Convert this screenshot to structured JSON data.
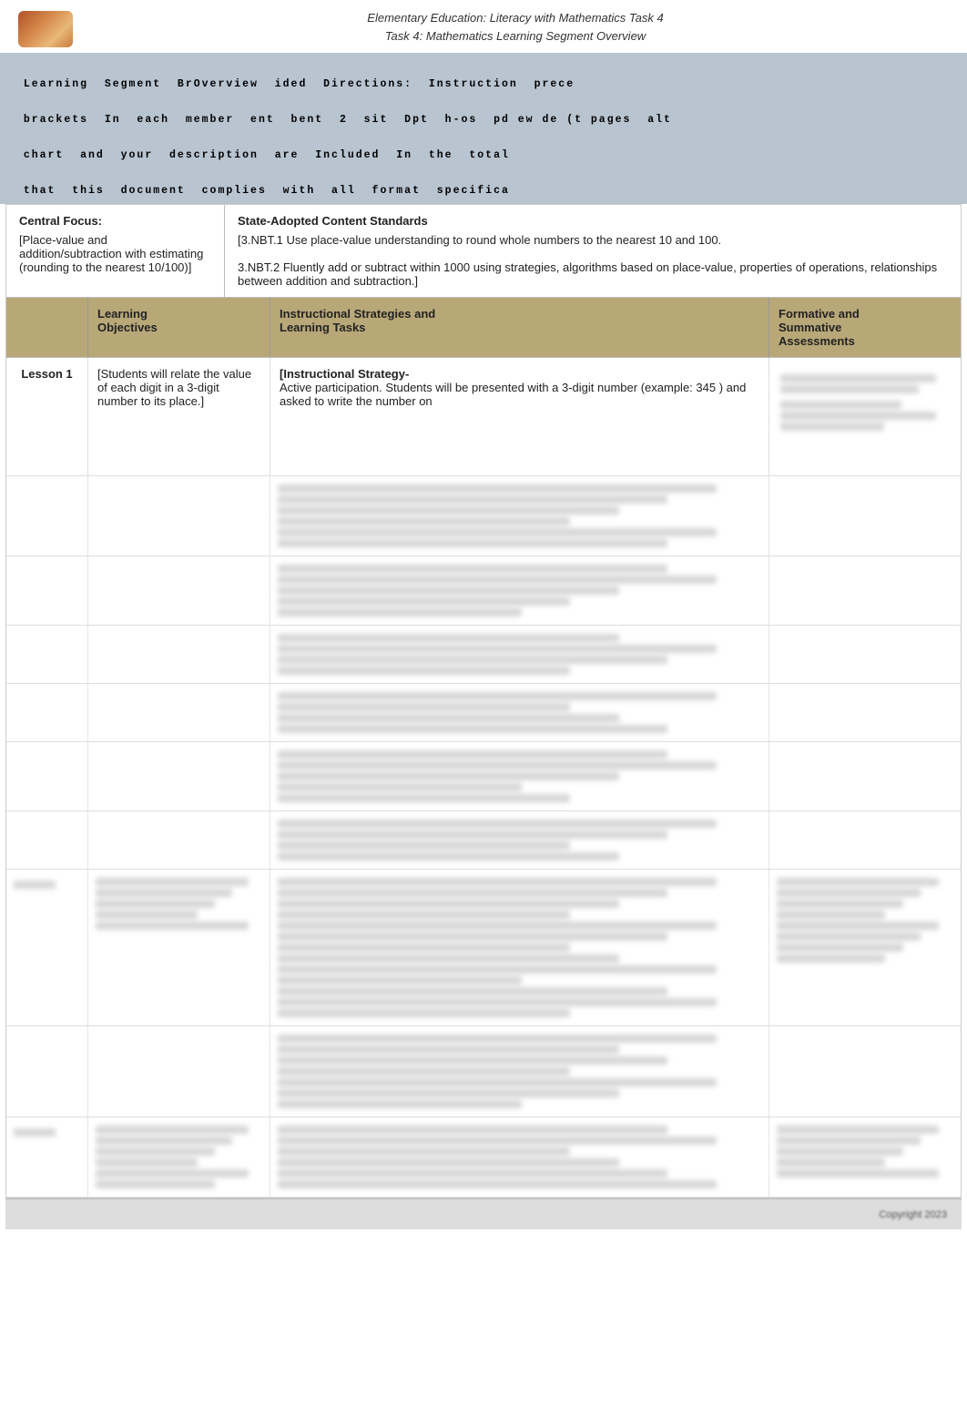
{
  "header": {
    "title_line1": "Elementary Education: Literacy with Mathematics Task 4",
    "title_line2": "Task 4: Mathematics Learning Segment Overview"
  },
  "banner": {
    "line1": "Learning  Segment  BrOverview  ided  Directions:  Instruction  prece",
    "line2": "brackets  In  each  member  ent  bent  2  sit  Dpt  h-os  pd ew de (t pages  alt",
    "line3": "chart  and  your  description  are  Included  In  the  total",
    "line4": "that  this  document  complies  with  all  format  specifica"
  },
  "central_focus": {
    "title": "Central Focus:",
    "text": "[Place-value and addition/subtraction with estimating (rounding to the nearest 10/100)]"
  },
  "state_standards": {
    "title": "State-Adopted Content Standards",
    "text": "[3.NBT.1 Use place-value understanding to round whole numbers to the nearest 10 and 100.\n3.NBT.2 Fluently add or subtract within 1000 using strategies, algorithms based on place-value, properties of operations, relationships between addition and subtraction.]"
  },
  "table": {
    "col_lesson": "Learning\nObjectives",
    "col_learning": "Learning\nObjectives",
    "col_instructional": "Instructional Strategies and\nLearning Tasks",
    "col_formative": "Formative and\nSummative\nAssessments",
    "lessons": [
      {
        "label": "Lesson 1",
        "objectives": "[Students will relate the value of each digit in a 3-digit number to its place.]",
        "instructional_header": "[Instructional Strategy-",
        "instructional_body": "Active participation. Students will be presented with a 3-digit number (example: 345 ) and asked to write the number on",
        "formative": ""
      }
    ]
  }
}
